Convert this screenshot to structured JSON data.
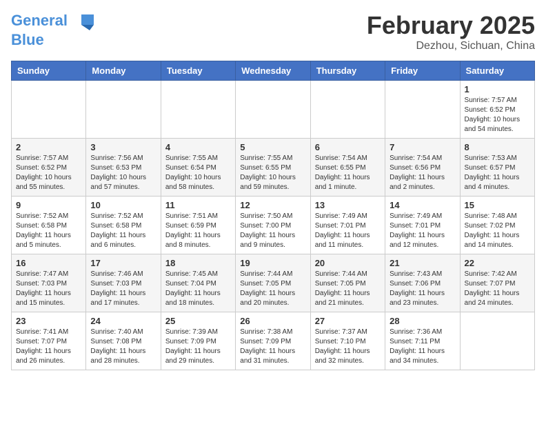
{
  "logo": {
    "line1": "General",
    "line2": "Blue"
  },
  "title": "February 2025",
  "location": "Dezhou, Sichuan, China",
  "days_of_week": [
    "Sunday",
    "Monday",
    "Tuesday",
    "Wednesday",
    "Thursday",
    "Friday",
    "Saturday"
  ],
  "weeks": [
    [
      {
        "day": "",
        "info": ""
      },
      {
        "day": "",
        "info": ""
      },
      {
        "day": "",
        "info": ""
      },
      {
        "day": "",
        "info": ""
      },
      {
        "day": "",
        "info": ""
      },
      {
        "day": "",
        "info": ""
      },
      {
        "day": "1",
        "info": "Sunrise: 7:57 AM\nSunset: 6:52 PM\nDaylight: 10 hours and 54 minutes."
      }
    ],
    [
      {
        "day": "2",
        "info": "Sunrise: 7:57 AM\nSunset: 6:52 PM\nDaylight: 10 hours and 55 minutes."
      },
      {
        "day": "3",
        "info": "Sunrise: 7:56 AM\nSunset: 6:53 PM\nDaylight: 10 hours and 57 minutes."
      },
      {
        "day": "4",
        "info": "Sunrise: 7:55 AM\nSunset: 6:54 PM\nDaylight: 10 hours and 58 minutes."
      },
      {
        "day": "5",
        "info": "Sunrise: 7:55 AM\nSunset: 6:55 PM\nDaylight: 10 hours and 59 minutes."
      },
      {
        "day": "6",
        "info": "Sunrise: 7:54 AM\nSunset: 6:55 PM\nDaylight: 11 hours and 1 minute."
      },
      {
        "day": "7",
        "info": "Sunrise: 7:54 AM\nSunset: 6:56 PM\nDaylight: 11 hours and 2 minutes."
      },
      {
        "day": "8",
        "info": "Sunrise: 7:53 AM\nSunset: 6:57 PM\nDaylight: 11 hours and 4 minutes."
      }
    ],
    [
      {
        "day": "9",
        "info": "Sunrise: 7:52 AM\nSunset: 6:58 PM\nDaylight: 11 hours and 5 minutes."
      },
      {
        "day": "10",
        "info": "Sunrise: 7:52 AM\nSunset: 6:58 PM\nDaylight: 11 hours and 6 minutes."
      },
      {
        "day": "11",
        "info": "Sunrise: 7:51 AM\nSunset: 6:59 PM\nDaylight: 11 hours and 8 minutes."
      },
      {
        "day": "12",
        "info": "Sunrise: 7:50 AM\nSunset: 7:00 PM\nDaylight: 11 hours and 9 minutes."
      },
      {
        "day": "13",
        "info": "Sunrise: 7:49 AM\nSunset: 7:01 PM\nDaylight: 11 hours and 11 minutes."
      },
      {
        "day": "14",
        "info": "Sunrise: 7:49 AM\nSunset: 7:01 PM\nDaylight: 11 hours and 12 minutes."
      },
      {
        "day": "15",
        "info": "Sunrise: 7:48 AM\nSunset: 7:02 PM\nDaylight: 11 hours and 14 minutes."
      }
    ],
    [
      {
        "day": "16",
        "info": "Sunrise: 7:47 AM\nSunset: 7:03 PM\nDaylight: 11 hours and 15 minutes."
      },
      {
        "day": "17",
        "info": "Sunrise: 7:46 AM\nSunset: 7:03 PM\nDaylight: 11 hours and 17 minutes."
      },
      {
        "day": "18",
        "info": "Sunrise: 7:45 AM\nSunset: 7:04 PM\nDaylight: 11 hours and 18 minutes."
      },
      {
        "day": "19",
        "info": "Sunrise: 7:44 AM\nSunset: 7:05 PM\nDaylight: 11 hours and 20 minutes."
      },
      {
        "day": "20",
        "info": "Sunrise: 7:44 AM\nSunset: 7:05 PM\nDaylight: 11 hours and 21 minutes."
      },
      {
        "day": "21",
        "info": "Sunrise: 7:43 AM\nSunset: 7:06 PM\nDaylight: 11 hours and 23 minutes."
      },
      {
        "day": "22",
        "info": "Sunrise: 7:42 AM\nSunset: 7:07 PM\nDaylight: 11 hours and 24 minutes."
      }
    ],
    [
      {
        "day": "23",
        "info": "Sunrise: 7:41 AM\nSunset: 7:07 PM\nDaylight: 11 hours and 26 minutes."
      },
      {
        "day": "24",
        "info": "Sunrise: 7:40 AM\nSunset: 7:08 PM\nDaylight: 11 hours and 28 minutes."
      },
      {
        "day": "25",
        "info": "Sunrise: 7:39 AM\nSunset: 7:09 PM\nDaylight: 11 hours and 29 minutes."
      },
      {
        "day": "26",
        "info": "Sunrise: 7:38 AM\nSunset: 7:09 PM\nDaylight: 11 hours and 31 minutes."
      },
      {
        "day": "27",
        "info": "Sunrise: 7:37 AM\nSunset: 7:10 PM\nDaylight: 11 hours and 32 minutes."
      },
      {
        "day": "28",
        "info": "Sunrise: 7:36 AM\nSunset: 7:11 PM\nDaylight: 11 hours and 34 minutes."
      },
      {
        "day": "",
        "info": ""
      }
    ]
  ]
}
